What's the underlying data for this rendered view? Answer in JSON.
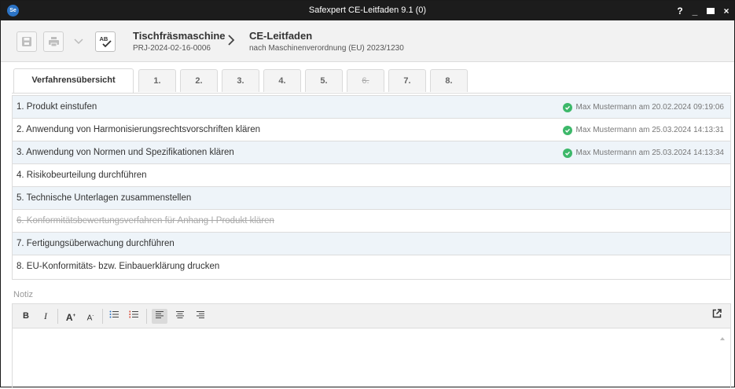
{
  "window": {
    "app_icon": "Se",
    "title": "Safexpert CE-Leitfaden 9.1 (0)",
    "help": "?",
    "minimize": "_",
    "close": "×"
  },
  "toolbar": {
    "product_title": "Tischfräsmaschine",
    "product_id": "PRJ-2024-02-16-0006",
    "doc_title": "CE-Leitfaden",
    "doc_subtitle": "nach Maschinenverordnung (EU) 2023/1230",
    "spellcheck_label": "AB"
  },
  "tabs": [
    {
      "label": "Verfahrensübersicht",
      "active": true
    },
    {
      "label": "1."
    },
    {
      "label": "2."
    },
    {
      "label": "3."
    },
    {
      "label": "4."
    },
    {
      "label": "5."
    },
    {
      "label": "6.",
      "struck": true
    },
    {
      "label": "7."
    },
    {
      "label": "8."
    }
  ],
  "steps": [
    {
      "label": "1. Produkt einstufen",
      "status": "Max Mustermann am 20.02.2024 09:19:06"
    },
    {
      "label": "2. Anwendung von Harmonisierungsrechtsvorschriften klären",
      "status": "Max Mustermann am 25.03.2024 14:13:31"
    },
    {
      "label": "3. Anwendung von Normen und Spezifikationen klären",
      "status": "Max Mustermann am 25.03.2024 14:13:34"
    },
    {
      "label": "4. Risikobeurteilung durchführen",
      "status": ""
    },
    {
      "label": "5. Technische Unterlagen zusammenstellen",
      "status": ""
    },
    {
      "label": "6. Konformitätsbewertungsverfahren für Anhang I Produkt klären",
      "status": ""
    },
    {
      "label": "7. Fertigungsüberwachung durchführen",
      "status": ""
    },
    {
      "label": "8. EU-Konformitäts- bzw. Einbauerklärung drucken",
      "status": ""
    }
  ],
  "notiz": {
    "label": "Notiz",
    "bold": "B",
    "italic": "I",
    "font_grow": "A",
    "font_shrink": "A",
    "content": ""
  },
  "colors": {
    "titlebar": "#1c1c1c",
    "row_alt": "#eef4f9",
    "check": "#3db86a",
    "accent": "#2b73c5"
  }
}
